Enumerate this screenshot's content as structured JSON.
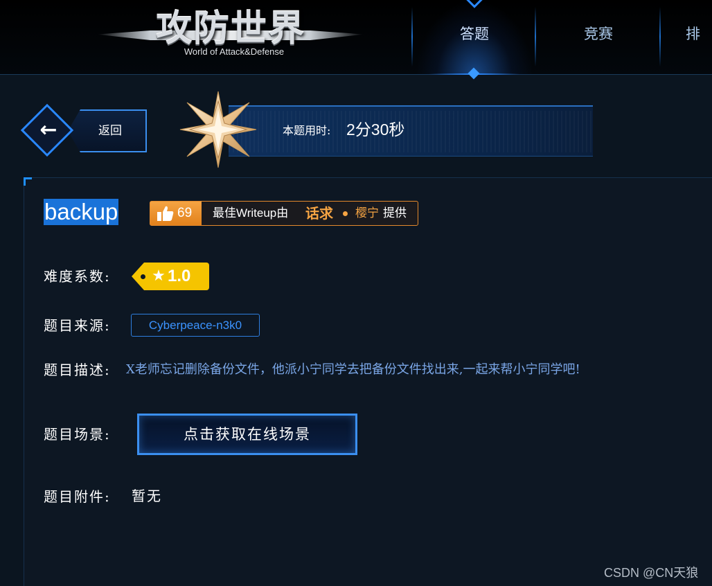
{
  "header": {
    "logo_title": "攻防世界",
    "logo_subtitle": "World of Attack&Defense",
    "nav": [
      {
        "label": "答题",
        "active": true
      },
      {
        "label": "竞赛",
        "active": false
      },
      {
        "label": "排行",
        "active": false
      }
    ]
  },
  "subbar": {
    "back_label": "返回",
    "timer_label": "本题用时:",
    "timer_value": "2分30秒"
  },
  "challenge": {
    "title": "backup",
    "likes": "69",
    "writeup_prefix_1": "最佳",
    "writeup_prefix_latin": "Writeup",
    "writeup_prefix_2": "由",
    "writeup_author_1": "话求",
    "writeup_author_2": "樱宁",
    "writeup_suffix": "提供",
    "difficulty_label": "难度系数:",
    "difficulty_value": "1.0",
    "source_label": "题目来源:",
    "source_value": "Cyberpeace-n3k0",
    "description_label": "题目描述:",
    "description_value": "X老师忘记删除备份文件，他派小宁同学去把备份文件找出来,一起来帮小宁同学吧!",
    "scene_label": "题目场景:",
    "scene_button": "点击获取在线场景",
    "attachment_label": "题目附件:",
    "attachment_value": "暂无"
  },
  "watermark": "CSDN @CN天狼",
  "colors": {
    "accent_blue": "#2a88ff",
    "badge_orange": "#f5a443",
    "difficulty_yellow": "#f5c400",
    "background": "#0b1520"
  },
  "icons": {
    "back": "arrow-left-icon",
    "timer": "compass-star-icon",
    "like": "thumbs-up-icon",
    "difficulty": "star-icon"
  }
}
